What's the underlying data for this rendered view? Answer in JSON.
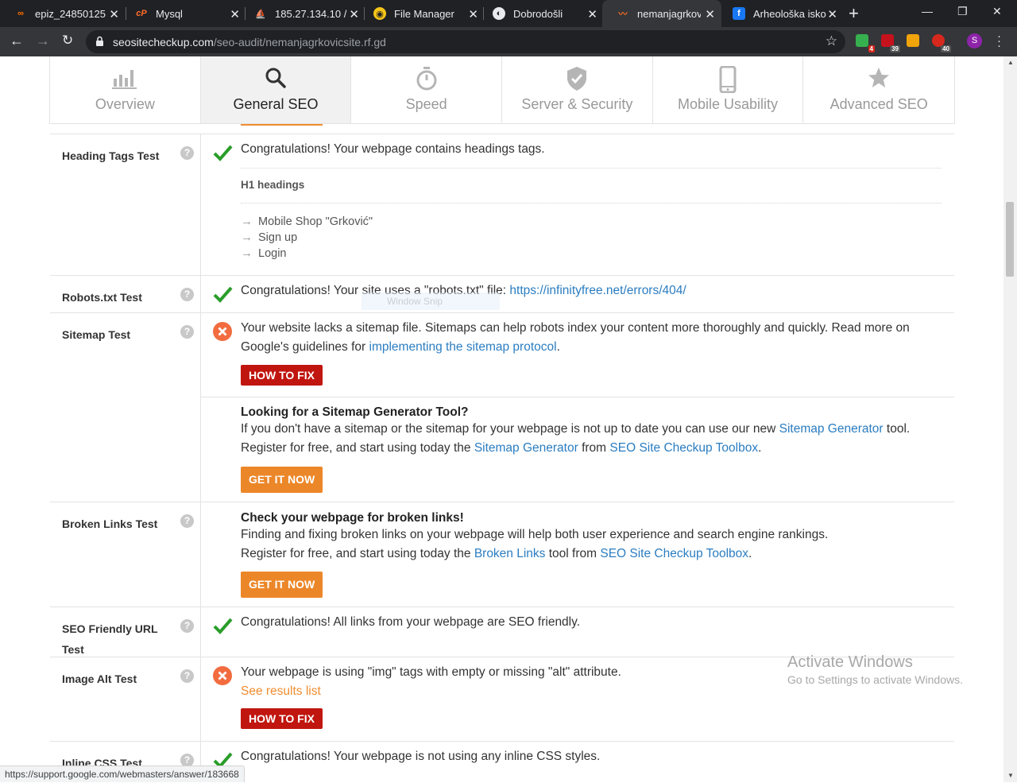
{
  "browser": {
    "tabs": [
      {
        "title": "epiz_24850125 (",
        "favicon": "infinity-icon",
        "color": "#ff6d00",
        "active": false
      },
      {
        "title": "Mysql",
        "favicon": "cpanel-icon",
        "color": "#ff6c2c",
        "active": false
      },
      {
        "title": "185.27.134.10 / ",
        "favicon": "phpmyadmin-icon",
        "color": "#f29111",
        "active": false
      },
      {
        "title": "File Manager",
        "favicon": "file-manager-icon",
        "color": "#f5c518",
        "active": false
      },
      {
        "title": "Dobrodošli",
        "favicon": "globe-icon",
        "color": "#e8eaed",
        "active": false
      },
      {
        "title": "nemanjagrkovic",
        "favicon": "seo-pulse-icon",
        "color": "#f26c22",
        "active": true
      },
      {
        "title": "Arheološka isko",
        "favicon": "facebook-icon",
        "color": "#1877f2",
        "active": false
      }
    ],
    "url_domain": "seositecheckup.com",
    "url_path": "/seo-audit/nemanjagrkovicsite.rf.gd",
    "extensions": [
      {
        "name": "adguard-extension-icon",
        "badge": "4",
        "color": "#36b04f"
      },
      {
        "name": "abp-extension-icon",
        "badge": "39",
        "color": "#c6121d"
      },
      {
        "name": "shopping-extension-icon",
        "badge": "",
        "color": "#f0a40a"
      },
      {
        "name": "alert-extension-icon",
        "badge": "40",
        "color": "#d6281c"
      }
    ],
    "avatar_letter": "S",
    "status_url": "https://support.google.com/webmasters/answer/183668"
  },
  "seo_nav": [
    {
      "label": "Overview",
      "icon": "bar-chart-icon",
      "active": false
    },
    {
      "label": "General SEO",
      "icon": "search-icon",
      "active": true
    },
    {
      "label": "Speed",
      "icon": "stopwatch-icon",
      "active": false
    },
    {
      "label": "Server & Security",
      "icon": "shield-check-icon",
      "active": false
    },
    {
      "label": "Mobile Usability",
      "icon": "mobile-phone-icon",
      "active": false
    },
    {
      "label": "Advanced SEO",
      "icon": "star-icon",
      "active": false
    }
  ],
  "tests": {
    "heading": {
      "name": "Heading Tags Test",
      "status": "pass",
      "message": "Congratulations! Your webpage contains headings tags.",
      "subhead": "H1 headings",
      "items": [
        "Mobile Shop \"Grković\"",
        "Sign up",
        "Login"
      ]
    },
    "robots": {
      "name": "Robots.txt Test",
      "status": "pass",
      "message": "Congratulations! Your site uses a \"robots.txt\" file:",
      "link": "https://infinityfree.net/errors/404/"
    },
    "sitemap": {
      "name": "Sitemap Test",
      "status": "fail",
      "message": "Your website lacks a sitemap file. Sitemaps can help robots index your content more thoroughly and quickly. Read more on Google's guidelines for",
      "link": "implementing the sitemap protocol",
      "message_end": ".",
      "fix_label": "HOW TO FIX",
      "promo_title": "Looking for a Sitemap Generator Tool?",
      "promo_text_1": "If you don't have a sitemap or the sitemap for your webpage is not up to date you can use our new",
      "promo_link_1": "Sitemap Generator",
      "promo_text_2": "tool. Register for free, and start using today the",
      "promo_link_2": "Sitemap Generator",
      "promo_text_3": "from",
      "promo_link_3": "SEO Site Checkup Toolbox",
      "promo_text_4": ".",
      "cta_label": "GET IT NOW"
    },
    "broken": {
      "name": "Broken Links Test",
      "title": "Check your webpage for broken links!",
      "line1": "Finding and fixing broken links on your webpage will help both user experience and search engine rankings.",
      "line2_a": "Register for free, and start using today the",
      "line2_link1": "Broken Links",
      "line2_b": "tool from",
      "line2_link2": "SEO Site Checkup Toolbox",
      "line2_c": ".",
      "cta_label": "GET IT NOW"
    },
    "seourl": {
      "name": "SEO Friendly URL Test",
      "status": "pass",
      "message": "Congratulations! All links from your webpage are SEO friendly."
    },
    "imgalt": {
      "name": "Image Alt Test",
      "status": "fail",
      "message": "Your webpage is using \"img\" tags with empty or missing \"alt\" attribute.",
      "results_link": "See results list",
      "fix_label": "HOW TO FIX"
    },
    "inlinecss": {
      "name": "Inline CSS Test",
      "status": "pass",
      "message": "Congratulations! Your webpage is not using any inline CSS styles."
    }
  },
  "overlays": {
    "snip_label": "Window Snip",
    "activate_title": "Activate Windows",
    "activate_sub": "Go to Settings to activate Windows."
  },
  "colors": {
    "pass": "#2a9d2a",
    "fail": "#f26c3f",
    "fix_button": "#c0160f",
    "cta_button": "#ec8729",
    "link": "#2b7dc1"
  }
}
